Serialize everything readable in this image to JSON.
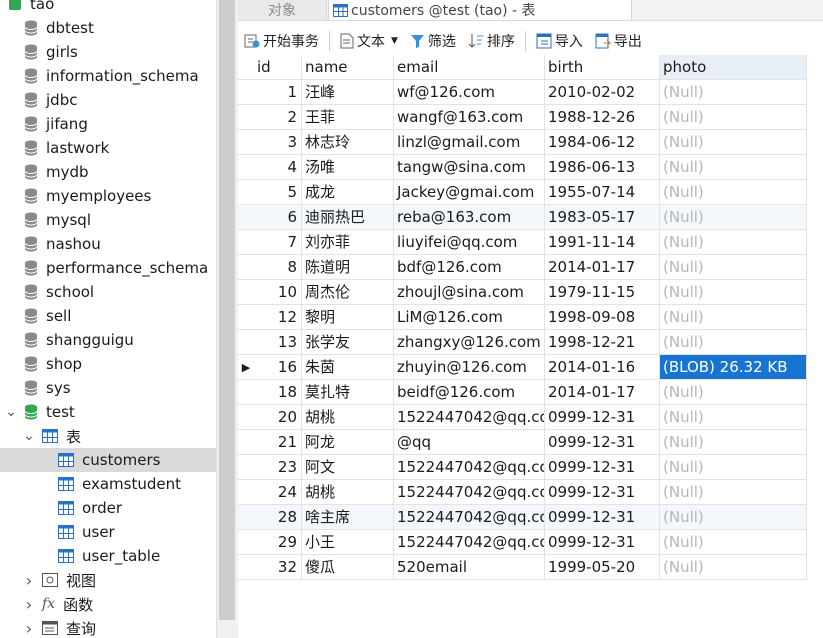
{
  "tree": {
    "connection": "tao",
    "databases": [
      "dbtest",
      "girls",
      "information_schema",
      "jdbc",
      "jifang",
      "lastwork",
      "mydb",
      "myemployees",
      "mysql",
      "nashou",
      "performance_schema",
      "school",
      "sell",
      "shangguigu",
      "shop",
      "sys"
    ],
    "open_db": "test",
    "tables_group": "表",
    "tables": [
      "customers",
      "examstudent",
      "order",
      "user",
      "user_table"
    ],
    "selected_table": "customers",
    "views_group": "视图",
    "functions_group": "函数",
    "queries_group": "查询"
  },
  "tabs": {
    "objects": "对象",
    "active": "customers @test (tao) - 表"
  },
  "toolbar": {
    "begin_transaction": "开始事务",
    "text": "文本",
    "filter": "筛选",
    "sort": "排序",
    "import": "导入",
    "export": "导出"
  },
  "grid": {
    "columns": [
      "id",
      "name",
      "email",
      "birth",
      "photo"
    ],
    "rows": [
      {
        "id": "1",
        "name": "汪峰",
        "email": "wf@126.com",
        "birth": "2010-02-02",
        "photo": "(Null)"
      },
      {
        "id": "2",
        "name": "王菲",
        "email": "wangf@163.com",
        "birth": "1988-12-26",
        "photo": "(Null)"
      },
      {
        "id": "3",
        "name": "林志玲",
        "email": "linzl@gmail.com",
        "birth": "1984-06-12",
        "photo": "(Null)"
      },
      {
        "id": "4",
        "name": "汤唯",
        "email": "tangw@sina.com",
        "birth": "1986-06-13",
        "photo": "(Null)"
      },
      {
        "id": "5",
        "name": "成龙",
        "email": "Jackey@gmai.com",
        "birth": "1955-07-14",
        "photo": "(Null)"
      },
      {
        "id": "6",
        "name": "迪丽热巴",
        "email": "reba@163.com",
        "birth": "1983-05-17",
        "photo": "(Null)"
      },
      {
        "id": "7",
        "name": "刘亦菲",
        "email": "liuyifei@qq.com",
        "birth": "1991-11-14",
        "photo": "(Null)"
      },
      {
        "id": "8",
        "name": "陈道明",
        "email": "bdf@126.com",
        "birth": "2014-01-17",
        "photo": "(Null)"
      },
      {
        "id": "10",
        "name": "周杰伦",
        "email": "zhoujl@sina.com",
        "birth": "1979-11-15",
        "photo": "(Null)"
      },
      {
        "id": "12",
        "name": "黎明",
        "email": "LiM@126.com",
        "birth": "1998-09-08",
        "photo": "(Null)"
      },
      {
        "id": "13",
        "name": "张学友",
        "email": "zhangxy@126.com",
        "birth": "1998-12-21",
        "photo": "(Null)"
      },
      {
        "id": "16",
        "name": "朱茵",
        "email": "zhuyin@126.com",
        "birth": "2014-01-16",
        "photo": "(BLOB) 26.32 KB"
      },
      {
        "id": "18",
        "name": "莫扎特",
        "email": "beidf@126.com",
        "birth": "2014-01-17",
        "photo": "(Null)"
      },
      {
        "id": "20",
        "name": "胡桃",
        "email": "1522447042@qq.co",
        "birth": "0999-12-31",
        "photo": "(Null)"
      },
      {
        "id": "21",
        "name": "阿龙",
        "email": "@qq",
        "birth": "0999-12-31",
        "photo": "(Null)"
      },
      {
        "id": "23",
        "name": "阿文",
        "email": "1522447042@qq.co",
        "birth": "0999-12-31",
        "photo": "(Null)"
      },
      {
        "id": "24",
        "name": "胡桃",
        "email": "1522447042@qq.co",
        "birth": "0999-12-31",
        "photo": "(Null)"
      },
      {
        "id": "28",
        "name": "啥主席",
        "email": "1522447042@qq.co",
        "birth": "0999-12-31",
        "photo": "(Null)"
      },
      {
        "id": "29",
        "name": "小王",
        "email": "1522447042@qq.co",
        "birth": "0999-12-31",
        "photo": "(Null)"
      },
      {
        "id": "32",
        "name": "傻瓜",
        "email": "520email",
        "birth": "1999-05-20",
        "photo": "(Null)"
      }
    ],
    "current_row_id": "16",
    "current_row_marker": "▶"
  },
  "colors": {
    "selection": "#1874d2",
    "null_text": "#b7b7b7",
    "db_icon": "#8a8a8a",
    "db_open_icon": "#2fa84f",
    "table_icon": "#2a6fc9"
  }
}
